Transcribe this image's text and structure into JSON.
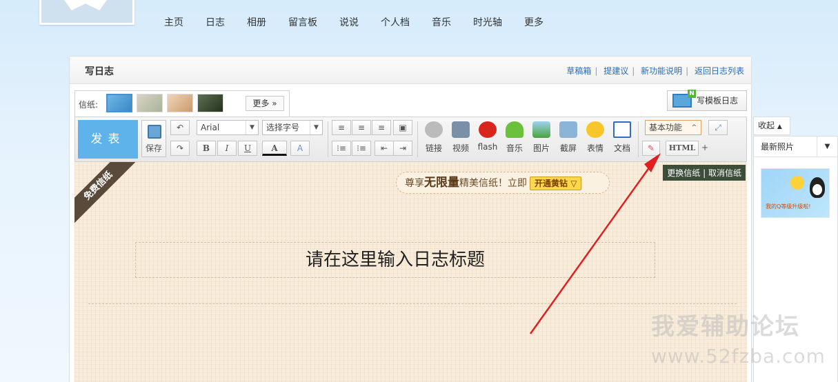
{
  "nav": [
    "主页",
    "日志",
    "相册",
    "留言板",
    "说说",
    "个人档",
    "音乐",
    "时光轴",
    "更多"
  ],
  "panel": {
    "title": "写日志",
    "links": [
      "草稿箱",
      "提建议",
      "新功能说明",
      "返回日志列表"
    ]
  },
  "stationery": {
    "label": "信纸:",
    "more": "更多 »"
  },
  "template_button": "写模板日志",
  "toolbar": {
    "publish": "发表",
    "save": "保存",
    "font": "Arial",
    "font_size": "选择字号",
    "media": [
      "链接",
      "视频",
      "flash",
      "音乐",
      "图片",
      "截屏",
      "表情",
      "文档"
    ],
    "feature_select": "基本功能",
    "html": "HTML",
    "bold": "B",
    "italic": "I",
    "underline": "U",
    "font_color": "A",
    "plus": "+"
  },
  "editor": {
    "ribbon": "免费信纸",
    "promo_prefix": "尊享",
    "promo_bold": "无限量",
    "promo_suffix": "精美信纸！立即",
    "promo_button": "开通黄钻",
    "change_paper": "更换信纸",
    "cancel_paper": "取消信纸",
    "title_placeholder": "请在这里输入日志标题"
  },
  "sidebar": {
    "toggle": "收起",
    "tab": "最新照片",
    "photo_caption": "我的Q等级升级啦!"
  },
  "watermark": {
    "line1": "我爱辅助论坛",
    "line2": "www.52fzba.com"
  },
  "colors": {
    "publish": "#5db3ea",
    "link": "#2a6bb7",
    "arrow": "#e02020"
  }
}
